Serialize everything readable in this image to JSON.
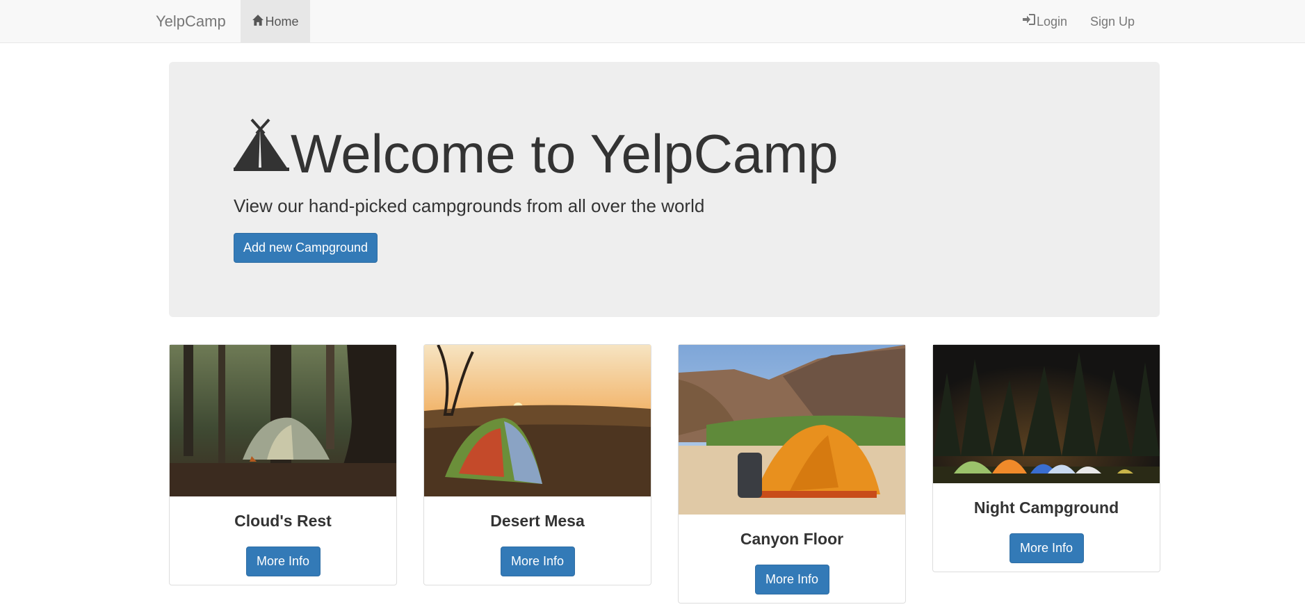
{
  "navbar": {
    "brand": "YelpCamp",
    "home_label": "Home",
    "login_label": "Login",
    "signup_label": "Sign Up",
    "icons": [
      "home-icon",
      "log-in-icon"
    ]
  },
  "jumbotron": {
    "title": "Welcome to YelpCamp",
    "subtitle": "View our hand-picked campgrounds from all over the world",
    "add_button": "Add new Campground",
    "icon": "tent-icon"
  },
  "campgrounds": [
    {
      "name": "Cloud's Rest",
      "button": "More Info"
    },
    {
      "name": "Desert Mesa",
      "button": "More Info"
    },
    {
      "name": "Canyon Floor",
      "button": "More Info"
    },
    {
      "name": "Night Campground",
      "button": "More Info"
    }
  ],
  "colors": {
    "primary": "#337ab7",
    "navbar_bg": "#f8f8f8",
    "jumbotron_bg": "#eeeeee",
    "text": "#333333"
  }
}
